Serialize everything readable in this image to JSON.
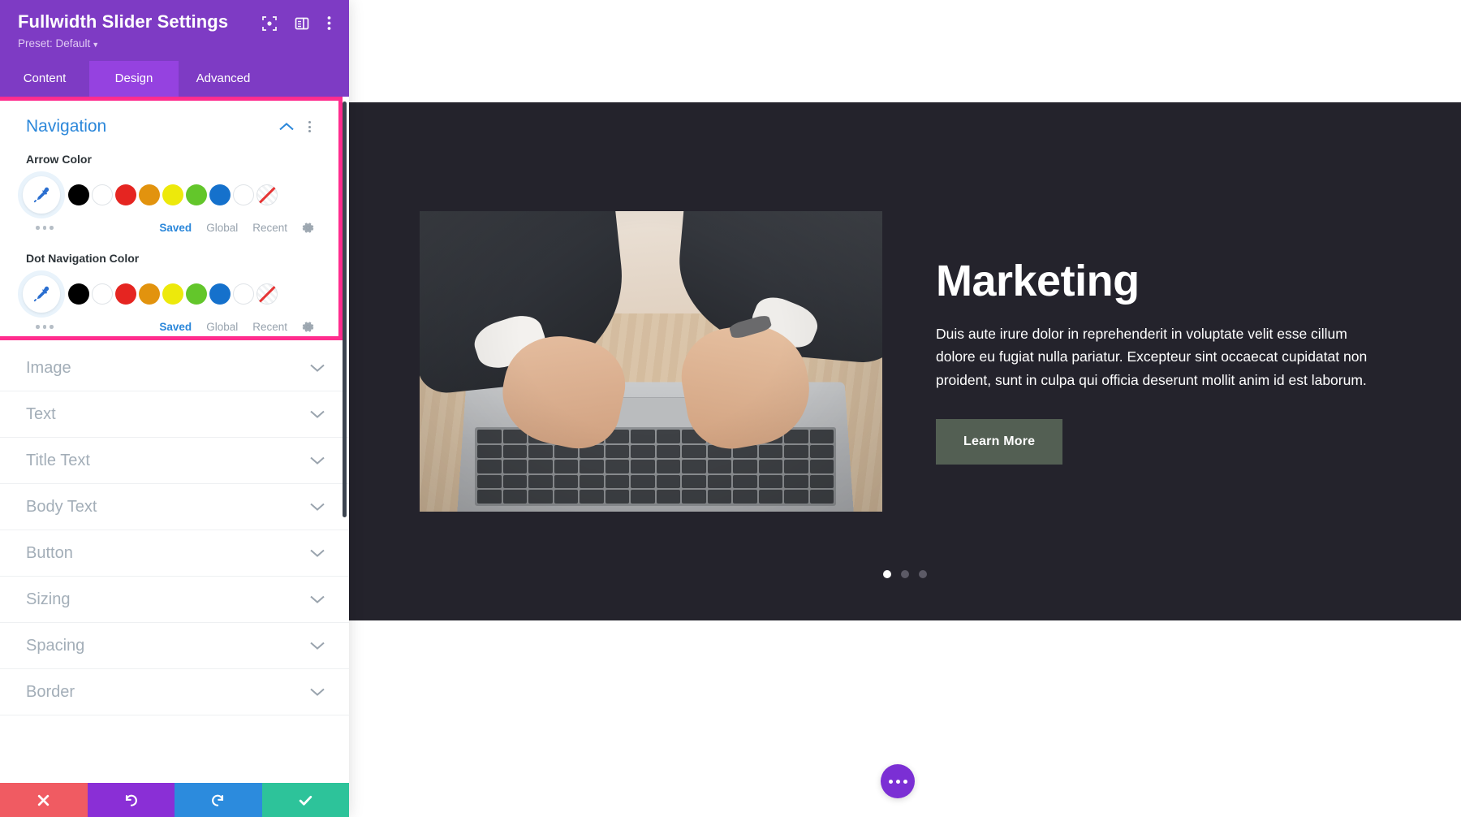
{
  "panel": {
    "title": "Fullwidth Slider Settings",
    "preset_label": "Preset: Default",
    "header_icons": [
      {
        "name": "focus-icon",
        "label": "focus"
      },
      {
        "name": "layout-toggle-icon",
        "label": "layout"
      },
      {
        "name": "more-options-icon",
        "label": "more"
      }
    ],
    "tabs": [
      {
        "label": "Content",
        "active": false
      },
      {
        "label": "Design",
        "active": true
      },
      {
        "label": "Advanced",
        "active": false
      }
    ],
    "navigation_section": {
      "title": "Navigation",
      "expanded": true,
      "highlighted": true,
      "highlight_color": "#FF2D8E",
      "fields": [
        {
          "label": "Arrow Color",
          "palette_tabs": [
            {
              "label": "Saved",
              "active": true
            },
            {
              "label": "Global",
              "active": false
            },
            {
              "label": "Recent",
              "active": false
            }
          ],
          "swatches": [
            {
              "name": "black",
              "color": "#000000"
            },
            {
              "name": "white",
              "color": "#ffffff"
            },
            {
              "name": "red",
              "color": "#E52521"
            },
            {
              "name": "orange",
              "color": "#E2930E"
            },
            {
              "name": "yellow",
              "color": "#EDE90B"
            },
            {
              "name": "green",
              "color": "#63C62B"
            },
            {
              "name": "blue",
              "color": "#1571CC"
            },
            {
              "name": "empty",
              "color": "#ffffff"
            },
            {
              "name": "transparent",
              "color": "none"
            }
          ]
        },
        {
          "label": "Dot Navigation Color",
          "palette_tabs": [
            {
              "label": "Saved",
              "active": true
            },
            {
              "label": "Global",
              "active": false
            },
            {
              "label": "Recent",
              "active": false
            }
          ],
          "swatches": [
            {
              "name": "black",
              "color": "#000000"
            },
            {
              "name": "white",
              "color": "#ffffff"
            },
            {
              "name": "red",
              "color": "#E52521"
            },
            {
              "name": "orange",
              "color": "#E2930E"
            },
            {
              "name": "yellow",
              "color": "#EDE90B"
            },
            {
              "name": "green",
              "color": "#63C62B"
            },
            {
              "name": "blue",
              "color": "#1571CC"
            },
            {
              "name": "empty",
              "color": "#ffffff"
            },
            {
              "name": "transparent",
              "color": "none"
            }
          ]
        }
      ]
    },
    "collapsed_sections": [
      {
        "label": "Image"
      },
      {
        "label": "Text"
      },
      {
        "label": "Title Text"
      },
      {
        "label": "Body Text"
      },
      {
        "label": "Button"
      },
      {
        "label": "Sizing"
      },
      {
        "label": "Spacing"
      },
      {
        "label": "Border"
      }
    ],
    "action_bar": [
      {
        "name": "cancel-button",
        "icon": "close-icon",
        "color": "#f05b62"
      },
      {
        "name": "undo-button",
        "icon": "undo-icon",
        "color": "#8a2fd6"
      },
      {
        "name": "redo-button",
        "icon": "redo-icon",
        "color": "#2C8BDD"
      },
      {
        "name": "save-button",
        "icon": "checkmark-icon",
        "color": "#2DC39A"
      }
    ]
  },
  "preview": {
    "background": "#24232c",
    "slide": {
      "title": "Marketing",
      "body": "Duis aute irure dolor in reprehenderit in voluptate velit esse cillum dolore eu fugiat nulla pariatur. Excepteur sint occaecat cupidatat non proident, sunt in culpa qui officia deserunt mollit anim id est laborum.",
      "button_label": "Learn More",
      "button_color": "#535f53",
      "image_alt": "hands typing on a laptop at a wooden desk"
    },
    "dots": [
      {
        "active": true
      },
      {
        "active": false
      },
      {
        "active": false
      }
    ],
    "fab": {
      "name": "page-settings-fab",
      "color": "#7b2fd4"
    }
  }
}
